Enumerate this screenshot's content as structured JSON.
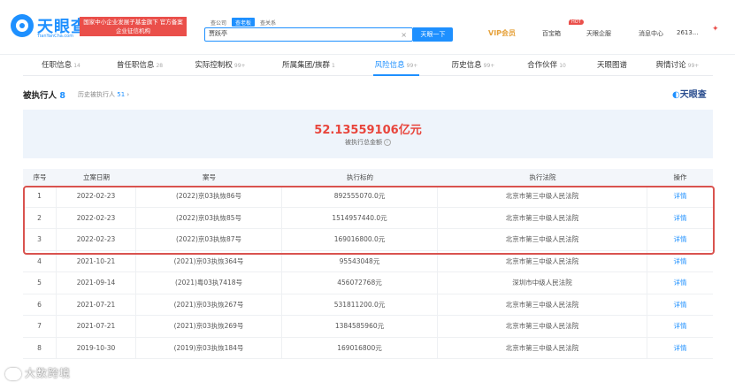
{
  "header": {
    "logo_text": "天眼查",
    "logo_sub": "TianYanCha.com",
    "promo": "国家中小企业发展子基金旗下 官方备案企业征信机构",
    "search_tabs": [
      "查公司",
      "查老板",
      "查关系"
    ],
    "search_value": "贾跃亭",
    "search_button": "天眼一下",
    "nav": {
      "vip": "VIP会员",
      "baibao": "百宝箱",
      "hot": "HOT",
      "tianyan": "天眼企服",
      "msg": "消息中心",
      "user": "2613..."
    }
  },
  "tabs": [
    {
      "label": "任职信息",
      "count": "14"
    },
    {
      "label": "曾任职信息",
      "count": "28"
    },
    {
      "label": "实际控制权",
      "count": "99+"
    },
    {
      "label": "所属集团/族群",
      "count": "1"
    },
    {
      "label": "风险信息",
      "count": "99+"
    },
    {
      "label": "历史信息",
      "count": "99+"
    },
    {
      "label": "合作伙伴",
      "count": "10"
    },
    {
      "label": "天眼图谱",
      "count": ""
    },
    {
      "label": "舆情讨论",
      "count": "99+"
    }
  ],
  "section": {
    "title": "被执行人",
    "count": "8",
    "history_label": "历史被执行人",
    "history_count": "51",
    "brand": "天眼查"
  },
  "summary": {
    "value": "52.13559106亿元",
    "label": "被执行总金额"
  },
  "table": {
    "headers": [
      "序号",
      "立案日期",
      "案号",
      "执行标的",
      "执行法院",
      "操作"
    ],
    "rows": [
      [
        "1",
        "2022-02-23",
        "(2022)京03执恢86号",
        "892555070.0元",
        "北京市第三中级人民法院",
        "详情"
      ],
      [
        "2",
        "2022-02-23",
        "(2022)京03执恢85号",
        "1514957440.0元",
        "北京市第三中级人民法院",
        "详情"
      ],
      [
        "3",
        "2022-02-23",
        "(2022)京03执恢87号",
        "169016800.0元",
        "北京市第三中级人民法院",
        "详情"
      ],
      [
        "4",
        "2021-10-21",
        "(2021)京03执恢364号",
        "95543048元",
        "北京市第三中级人民法院",
        "详情"
      ],
      [
        "5",
        "2021-09-14",
        "(2021)粤03执7418号",
        "456072768元",
        "深圳市中级人民法院",
        "详情"
      ],
      [
        "6",
        "2021-07-21",
        "(2021)京03执恢267号",
        "531811200.0元",
        "北京市第三中级人民法院",
        "详情"
      ],
      [
        "7",
        "2021-07-21",
        "(2021)京03执恢269号",
        "1384585960元",
        "北京市第三中级人民法院",
        "详情"
      ],
      [
        "8",
        "2019-10-30",
        "(2019)京03执恢184号",
        "169016800元",
        "北京市第三中级人民法院",
        "详情"
      ]
    ]
  },
  "watermark": "大数跨境",
  "colors": {
    "accent": "#1e90ff",
    "danger": "#e8453c",
    "highlight": "#d9534f"
  }
}
